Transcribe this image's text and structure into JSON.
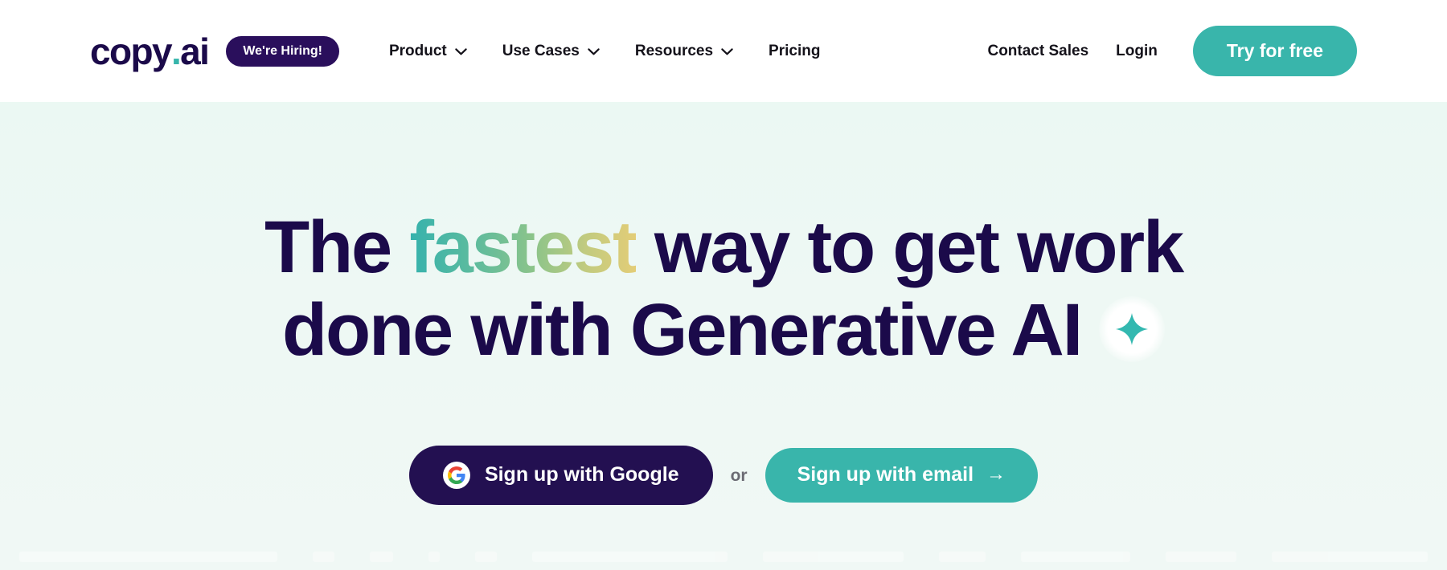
{
  "navbar": {
    "logo": {
      "name": "copy",
      "dot": ".",
      "suffix": "ai"
    },
    "hiring_badge": "We're Hiring!",
    "menu": [
      {
        "label": "Product",
        "has_dropdown": true,
        "icon": "chevron-down-icon"
      },
      {
        "label": "Use Cases",
        "has_dropdown": true,
        "icon": "chevron-down-icon"
      },
      {
        "label": "Resources",
        "has_dropdown": true,
        "icon": "chevron-down-icon"
      },
      {
        "label": "Pricing",
        "has_dropdown": false,
        "icon": ""
      }
    ],
    "contact_sales": "Contact Sales",
    "login": "Login",
    "try_free": "Try for free"
  },
  "hero": {
    "headline": {
      "line1_a": "The ",
      "line1_gradient": "fastest",
      "line1_b": " way to get work",
      "line2": "done with Generative AI",
      "sparkle_icon": "sparkle-icon"
    },
    "cta": {
      "google_label": "Sign up with Google",
      "google_icon": "google-g-icon",
      "or_label": "or",
      "email_label": "Sign up with email",
      "email_arrow": "→"
    }
  },
  "colors": {
    "brand_navy": "#1b0a4a",
    "brand_teal": "#39b5ab",
    "badge_purple": "#2a0f5c",
    "google_btn_bg": "#231051",
    "hero_bg": "#eef8f4",
    "gradient_start": "#35b2ad",
    "gradient_mid": "#8cc48a",
    "gradient_end": "#e3cd77"
  }
}
